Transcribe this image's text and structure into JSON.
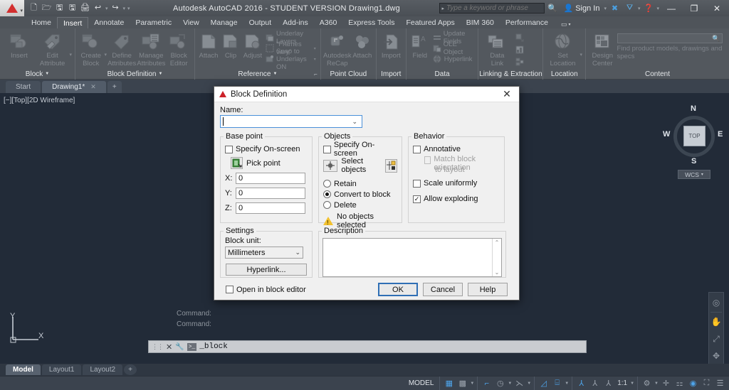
{
  "titlebar": {
    "app_title": "Autodesk AutoCAD 2016 - STUDENT VERSION   Drawing1.dwg",
    "quick_access": [
      {
        "name": "new-icon",
        "glyph": "🗋"
      },
      {
        "name": "open-icon",
        "glyph": "🗁"
      },
      {
        "name": "save-icon",
        "glyph": "🖫"
      },
      {
        "name": "save-as-icon",
        "glyph": "🖫"
      },
      {
        "name": "plot-icon",
        "glyph": "🖨"
      },
      {
        "name": "undo-icon",
        "glyph": "↩"
      },
      {
        "name": "redo-icon",
        "glyph": "↪"
      }
    ],
    "search_placeholder": "Type a keyword or phrase",
    "sign_in": "Sign In",
    "minimize": "—",
    "maximize": "❐",
    "close": "✕"
  },
  "ribbon": {
    "tabs": [
      {
        "label": "Home",
        "active": false
      },
      {
        "label": "Insert",
        "active": true
      },
      {
        "label": "Annotate",
        "active": false
      },
      {
        "label": "Parametric",
        "active": false
      },
      {
        "label": "View",
        "active": false
      },
      {
        "label": "Manage",
        "active": false
      },
      {
        "label": "Output",
        "active": false
      },
      {
        "label": "Add-ins",
        "active": false
      },
      {
        "label": "A360",
        "active": false
      },
      {
        "label": "Express Tools",
        "active": false
      },
      {
        "label": "Featured Apps",
        "active": false
      },
      {
        "label": "BIM 360",
        "active": false
      },
      {
        "label": "Performance",
        "active": false
      }
    ],
    "panels": {
      "block": {
        "title": "Block",
        "buttons": [
          {
            "label": "Insert",
            "icon": "insert-block-icon"
          },
          {
            "label": "Edit\nAttribute",
            "label1": "Edit",
            "label2": "Attribute",
            "icon": "edit-attribute-icon"
          }
        ]
      },
      "block_definition": {
        "title": "Block Definition",
        "buttons": [
          {
            "label1": "Create",
            "label2": "Block",
            "icon": "create-block-icon"
          },
          {
            "label1": "Define",
            "label2": "Attributes",
            "icon": "define-attributes-icon"
          },
          {
            "label1": "Manage",
            "label2": "Attributes",
            "icon": "manage-attributes-icon"
          },
          {
            "label1": "Block",
            "label2": "Editor",
            "icon": "block-editor-icon"
          }
        ]
      },
      "reference": {
        "title": "Reference",
        "buttons": [
          {
            "label": "Attach",
            "icon": "attach-icon"
          },
          {
            "label": "Clip",
            "icon": "clip-icon"
          },
          {
            "label": "Adjust",
            "icon": "adjust-icon"
          }
        ],
        "small_buttons": [
          {
            "label": "Underlay Layers",
            "icon": "underlay-layers-icon"
          },
          {
            "label": "\"Frames vary\"",
            "icon": "frames-vary-icon"
          },
          {
            "label": "Snap to Underlays ON",
            "icon": "snap-underlays-icon"
          }
        ]
      },
      "point_cloud": {
        "title": "Point Cloud",
        "buttons": [
          {
            "label1": "Autodesk",
            "label2": "ReCap",
            "icon": "autodesk-recap-icon"
          },
          {
            "label1": "Attach",
            "label2": "",
            "icon": "attach-pointcloud-icon"
          }
        ]
      },
      "import": {
        "title": "Import",
        "buttons": [
          {
            "label": "Import",
            "icon": "import-icon"
          }
        ]
      },
      "data": {
        "title": "Data",
        "buttons": [
          {
            "label": "Field",
            "icon": "field-icon"
          }
        ],
        "small_buttons": [
          {
            "label": "Update Fields",
            "icon": "update-fields-icon"
          },
          {
            "label": "OLE Object",
            "icon": "ole-object-icon"
          },
          {
            "label": "Hyperlink",
            "icon": "hyperlink-icon"
          }
        ]
      },
      "linking": {
        "title": "Linking & Extraction",
        "buttons": [
          {
            "label1": "Data",
            "label2": "Link",
            "icon": "data-link-icon"
          }
        ],
        "small_buttons": [
          {
            "label": "",
            "icon": "extract-data-icon"
          },
          {
            "label": "",
            "icon": "data-extraction-icon"
          },
          {
            "label": "",
            "icon": "download-from-source-icon"
          }
        ]
      },
      "location": {
        "title": "Location",
        "buttons": [
          {
            "label1": "Set",
            "label2": "Location",
            "icon": "set-location-icon"
          }
        ]
      },
      "content": {
        "title": "Content",
        "buttons": [
          {
            "label1": "Design",
            "label2": "Center",
            "icon": "design-center-icon"
          }
        ],
        "search_hint": "Find product models, drawings and specs"
      }
    }
  },
  "file_tabs": [
    {
      "label": "Start",
      "active": false,
      "closable": false
    },
    {
      "label": "Drawing1*",
      "active": true,
      "closable": true
    }
  ],
  "file_tab_add": "+",
  "canvas": {
    "viewport_label": "[−][Top][2D Wireframe]",
    "viewcube": {
      "north": "N",
      "south": "S",
      "west": "W",
      "east": "E",
      "face": "TOP",
      "ucs": "WCS"
    },
    "navbar": [
      {
        "name": "steering-wheel-icon",
        "glyph": "◎"
      },
      {
        "name": "pan-icon",
        "glyph": "✋"
      },
      {
        "name": "zoom-extents-icon",
        "glyph": "⤢"
      },
      {
        "name": "orbit-icon",
        "glyph": "✥"
      },
      {
        "name": "showmotion-icon",
        "glyph": "▣"
      }
    ],
    "ucs_x": "X",
    "ucs_y": "Y"
  },
  "command": {
    "history": [
      "Command:",
      "Command:"
    ],
    "prompt_glyph": "⌄",
    "input_value": "_block",
    "close_icon": "✕",
    "settings_icon": "🔧"
  },
  "layout_tabs": [
    {
      "label": "Model",
      "active": true
    },
    {
      "label": "Layout1",
      "active": false
    },
    {
      "label": "Layout2",
      "active": false
    }
  ],
  "layout_tab_add": "+",
  "statusbar": {
    "model_label": "MODEL",
    "scale": "1:1",
    "icons": [
      {
        "name": "grid-display-icon",
        "glyph": "▦",
        "on": true
      },
      {
        "name": "snap-mode-icon",
        "glyph": "▩",
        "on": false
      },
      {
        "name": "ortho-mode-icon",
        "glyph": "⌐",
        "on": true
      },
      {
        "name": "polar-tracking-icon",
        "glyph": "◷",
        "on": false
      },
      {
        "name": "object-snap-icon",
        "glyph": "⌁",
        "on": false
      },
      {
        "name": "object-snap-tracking-icon",
        "glyph": "∠",
        "on": true
      },
      {
        "name": "ucs-icon",
        "glyph": "⌸",
        "on": true
      },
      {
        "name": "annotation-visibility-icon",
        "glyph": "⅄",
        "on": true
      },
      {
        "name": "autoscale-icon",
        "glyph": "⅄",
        "on": false
      },
      {
        "name": "annotation-scale-icon",
        "glyph": "⅄",
        "on": false
      },
      {
        "name": "workspace-switching-icon",
        "glyph": "⚙",
        "on": false
      },
      {
        "name": "hardware-acceleration-icon",
        "glyph": "✛",
        "on": false
      },
      {
        "name": "isolate-objects-icon",
        "glyph": "⚏",
        "on": false
      },
      {
        "name": "clean-screen-icon",
        "glyph": "◉",
        "on": true
      },
      {
        "name": "viewport-icon",
        "glyph": "⛶",
        "on": false
      },
      {
        "name": "customization-icon",
        "glyph": "☰",
        "on": false
      }
    ]
  },
  "dialog": {
    "title": "Block Definition",
    "close_label": "✕",
    "name_label": "Name:",
    "name_value": "",
    "base_point": {
      "legend": "Base point",
      "specify_onscreen_label": "Specify On-screen",
      "specify_onscreen_checked": false,
      "pick_point_label": "Pick point",
      "x_label": "X:",
      "x_value": "0",
      "y_label": "Y:",
      "y_value": "0",
      "z_label": "Z:",
      "z_value": "0"
    },
    "objects": {
      "legend": "Objects",
      "specify_onscreen_label": "Specify On-screen",
      "specify_onscreen_checked": false,
      "select_objects_label": "Select objects",
      "radios": [
        {
          "label": "Retain",
          "selected": false
        },
        {
          "label": "Convert to block",
          "selected": true
        },
        {
          "label": "Delete",
          "selected": false
        }
      ],
      "warning_text": "No objects selected"
    },
    "behavior": {
      "legend": "Behavior",
      "annotative_label": "Annotative",
      "annotative_checked": false,
      "match_orientation_label_1": "Match block orientation",
      "match_orientation_label_2": "to layout",
      "match_orientation_checked": false,
      "match_orientation_disabled": true,
      "scale_uniformly_label": "Scale uniformly",
      "scale_uniformly_checked": false,
      "allow_exploding_label": "Allow exploding",
      "allow_exploding_checked": true
    },
    "settings": {
      "legend": "Settings",
      "block_unit_label": "Block unit:",
      "block_unit_value": "Millimeters",
      "hyperlink_label": "Hyperlink..."
    },
    "description": {
      "legend": "Description",
      "value": ""
    },
    "open_in_block_editor_label": "Open in block editor",
    "open_in_block_editor_checked": false,
    "ok_label": "OK",
    "cancel_label": "Cancel",
    "help_label": "Help"
  },
  "colors": {
    "dialog_bg": "#f0f0f0",
    "canvas_bg": "#222b38",
    "ribbon_bg": "#53585e",
    "accent_blue": "#4a90d9",
    "autodesk_red": "#cc2229",
    "warning_yellow": "#f2c12e",
    "status_on_blue": "#4ea3e8"
  }
}
